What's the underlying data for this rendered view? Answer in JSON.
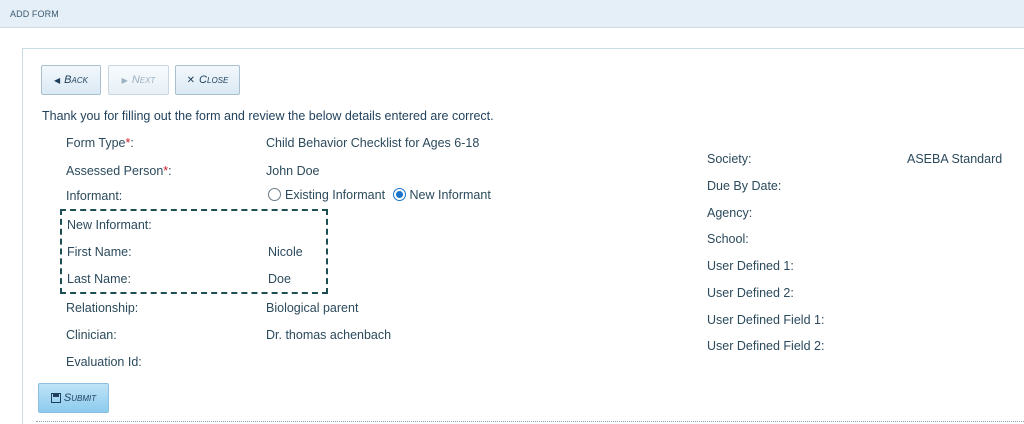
{
  "header": {
    "title": "ADD FORM"
  },
  "toolbar": {
    "back_label": "Back",
    "next_label": "Next",
    "close_label": "Close"
  },
  "intro_text": "Thank you for filling out the form and review the below details entered are correct.",
  "form": {
    "form_type_label": "Form Type",
    "form_type_value": "Child Behavior Checklist for Ages 6-18",
    "assessed_label": "Assessed Person",
    "assessed_value": "John Doe",
    "required_mark": "*",
    "informant_label": "Informant:",
    "informant_options": [
      "Existing Informant",
      "New Informant"
    ],
    "informant_selected": "New Informant",
    "new_informant_label": "New Informant:",
    "first_name_label": "First Name:",
    "first_name_value": "Nicole",
    "last_name_label": "Last Name:",
    "last_name_value": "Doe",
    "relationship_label": "Relationship:",
    "relationship_value": "Biological parent",
    "clinician_label": "Clinician:",
    "clinician_value": "Dr. thomas achenbach",
    "evaluation_label": "Evaluation Id:"
  },
  "right": {
    "society_label": "Society:",
    "society_value": "ASEBA Standard",
    "due_label": "Due By Date:",
    "agency_label": "Agency:",
    "school_label": "School:",
    "ud1_label": "User Defined 1:",
    "ud2_label": "User Defined 2:",
    "udf1_label": "User Defined Field 1:",
    "udf2_label": "User Defined Field 2:"
  },
  "submit_label": "Submit"
}
